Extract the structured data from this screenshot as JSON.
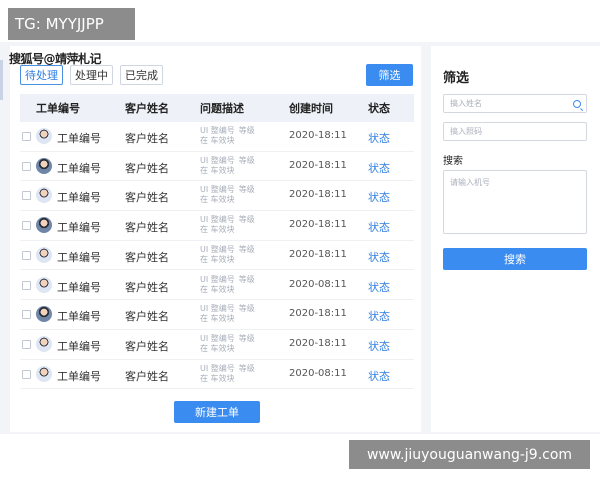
{
  "overlay": {
    "tg_badge": "TG: MYYJJPP",
    "top_watermark": "搜狐号@靖萍札记",
    "bottom_watermark": "www.jiuyouguanwang-j9.com"
  },
  "tabs": [
    {
      "label": "待处理",
      "active": true
    },
    {
      "label": "处理中",
      "active": false
    },
    {
      "label": "已完成",
      "active": false
    }
  ],
  "toolbar": {
    "filter_label": "筛选"
  },
  "table": {
    "headers": [
      "工单编号",
      "客户姓名",
      "问题描述",
      "创建时间",
      "状态"
    ],
    "rows": [
      {
        "id": "工单编号",
        "name": "客户姓名",
        "desc_line1": "UI 整编号",
        "desc_level": "等级",
        "desc_line2": "在 车效块",
        "time": "2020-18:11",
        "status": "状态",
        "avatar": "light"
      },
      {
        "id": "工单编号",
        "name": "客户姓名",
        "desc_line1": "UI 整编号",
        "desc_level": "等级",
        "desc_line2": "在 车效块",
        "time": "2020-18:11",
        "status": "状态",
        "avatar": "dark"
      },
      {
        "id": "工单编号",
        "name": "客户姓名",
        "desc_line1": "UI 整编号",
        "desc_level": "等级",
        "desc_line2": "在 车效块",
        "time": "2020-18:11",
        "status": "状态",
        "avatar": "light"
      },
      {
        "id": "工单编号",
        "name": "客户姓名",
        "desc_line1": "UI 整编号",
        "desc_level": "等级",
        "desc_line2": "在 车效块",
        "time": "2020-18:11",
        "status": "状态",
        "avatar": "dark"
      },
      {
        "id": "工单编号",
        "name": "客户姓名",
        "desc_line1": "UI 整编号",
        "desc_level": "等级",
        "desc_line2": "在 车效块",
        "time": "2020-18:11",
        "status": "状态",
        "avatar": "light"
      },
      {
        "id": "工单编号",
        "name": "客户姓名",
        "desc_line1": "UI 整编号",
        "desc_level": "等级",
        "desc_line2": "在 车效块",
        "time": "2020-08:11",
        "status": "状态",
        "avatar": "light"
      },
      {
        "id": "工单编号",
        "name": "客户姓名",
        "desc_line1": "UI 整编号",
        "desc_level": "等级",
        "desc_line2": "在 车效块",
        "time": "2020-18:11",
        "status": "状态",
        "avatar": "dark"
      },
      {
        "id": "工单编号",
        "name": "客户姓名",
        "desc_line1": "UI 整编号",
        "desc_level": "等级",
        "desc_line2": "在 车效块",
        "time": "2020-18:11",
        "status": "状态",
        "avatar": "light"
      },
      {
        "id": "工单编号",
        "name": "客户姓名",
        "desc_line1": "UI 整编号",
        "desc_level": "等级",
        "desc_line2": "在 车效块",
        "time": "2020-08:11",
        "status": "状态",
        "avatar": "light"
      }
    ]
  },
  "footer": {
    "new_ticket_label": "新建工单"
  },
  "sidebar": {
    "title": "筛选",
    "name_placeholder": "搞入姓名",
    "number_placeholder": "搞入照码",
    "search_label": "搜索",
    "phone_placeholder": "请输入机号",
    "search_button": "搜索"
  },
  "colors": {
    "accent": "#3b8cf0",
    "status": "#2f7de1",
    "background": "#f2f4f8"
  }
}
